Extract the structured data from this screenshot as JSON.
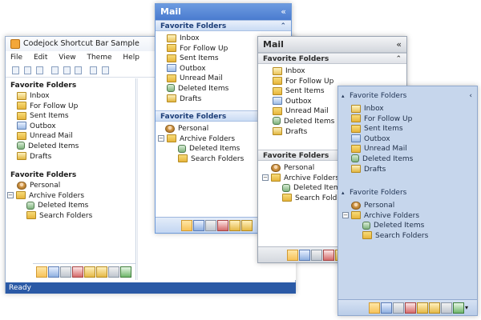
{
  "w1": {
    "title": "Codejock Shortcut Bar Sample",
    "menu": [
      "File",
      "Edit",
      "View",
      "Theme",
      "Help"
    ],
    "fav_header": "Favorite Folders",
    "fav_items": [
      "Inbox",
      "For Follow Up",
      "Sent Items",
      "Outbox",
      "Unread Mail",
      "Deleted Items",
      "Drafts"
    ],
    "fav2_header": "Favorite Folders",
    "tree": {
      "personal": "Personal",
      "archive": "Archive Folders",
      "deleted": "Deleted Items",
      "search": "Search Folders"
    },
    "status": "Ready"
  },
  "w2": {
    "caption": "Mail",
    "chev": "«",
    "fav_header": "Favorite Folders",
    "fav_items": [
      "Inbox",
      "For Follow Up",
      "Sent Items",
      "Outbox",
      "Unread Mail",
      "Deleted Items",
      "Drafts"
    ],
    "fav2_header": "Favorite Folders",
    "tree": {
      "personal": "Personal",
      "archive": "Archive Folders",
      "deleted": "Deleted Items",
      "search": "Search Folders"
    }
  },
  "w3": {
    "caption": "Mail",
    "chev": "«",
    "fav_header": "Favorite Folders",
    "fav_items": [
      "Inbox",
      "For Follow Up",
      "Sent Items",
      "Outbox",
      "Unread Mail",
      "Deleted Items",
      "Drafts"
    ],
    "fav2_header": "Favorite Folders",
    "tree": {
      "personal": "Personal",
      "archive": "Archive Folders",
      "deleted": "Deleted Items",
      "search": "Search Folders"
    }
  },
  "w4": {
    "fav_header": "Favorite Folders",
    "chev": "‹",
    "fav_items": [
      "Inbox",
      "For Follow Up",
      "Sent Items",
      "Outbox",
      "Unread Mail",
      "Deleted Items",
      "Drafts"
    ],
    "fav2_header": "Favorite Folders",
    "tree": {
      "personal": "Personal",
      "archive": "Archive Folders",
      "deleted": "Deleted Items",
      "search": "Search Folders"
    }
  },
  "colors": {
    "status_bar": "#2b5aa6",
    "blue_caption": "#4a7bcf",
    "light_blue_bg": "#c6d6ec"
  }
}
